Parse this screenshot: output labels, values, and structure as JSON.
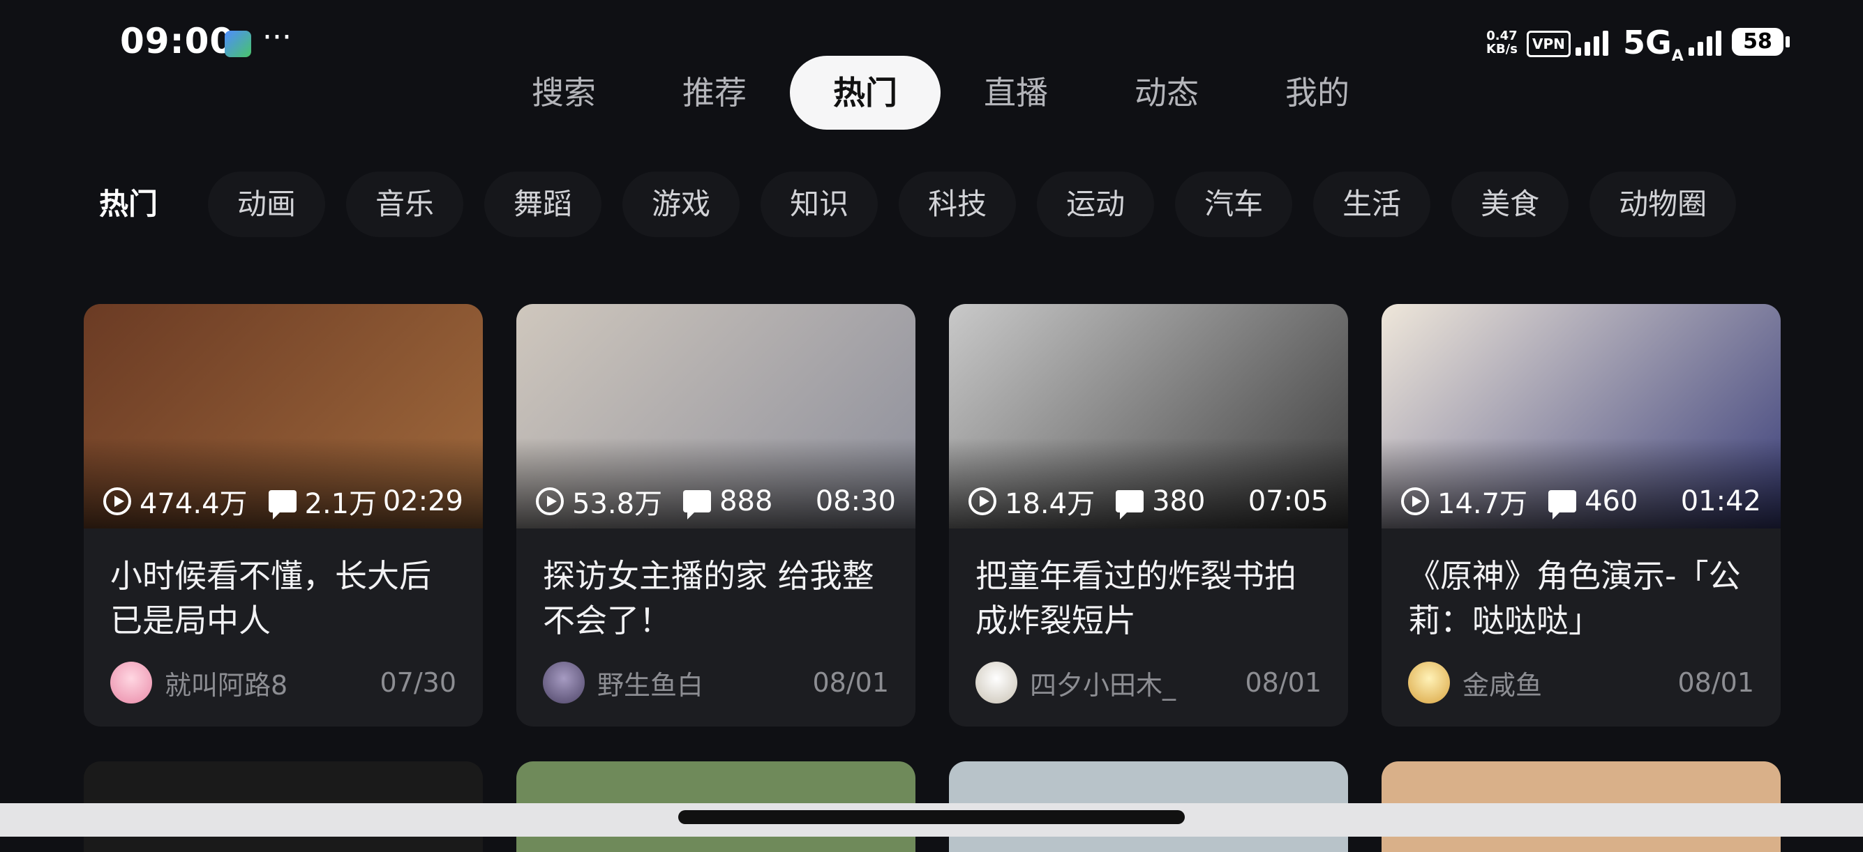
{
  "status_bar": {
    "time": "09:00",
    "app_icon": "app-notification-icon",
    "more": "···",
    "net_speed_value": "0.47",
    "net_speed_unit": "KB/s",
    "vpn": "VPN",
    "network": "5G",
    "network_suffix": "A",
    "battery": "58"
  },
  "top_tabs": [
    {
      "label": "搜索"
    },
    {
      "label": "推荐"
    },
    {
      "label": "热门",
      "active": true
    },
    {
      "label": "直播"
    },
    {
      "label": "动态"
    },
    {
      "label": "我的"
    }
  ],
  "categories": [
    {
      "label": "热门",
      "active": true
    },
    {
      "label": "动画"
    },
    {
      "label": "音乐"
    },
    {
      "label": "舞蹈"
    },
    {
      "label": "游戏"
    },
    {
      "label": "知识"
    },
    {
      "label": "科技"
    },
    {
      "label": "运动"
    },
    {
      "label": "汽车"
    },
    {
      "label": "生活"
    },
    {
      "label": "美食"
    },
    {
      "label": "动物圈"
    }
  ],
  "videos": [
    {
      "views": "474.4万",
      "comments": "2.1万",
      "duration": "02:29",
      "title": "小时候看不懂，长大后已是局中人",
      "author": "就叫阿路8",
      "date": "07/30",
      "thumb_colors": [
        "#6b3b24",
        "#a0693c"
      ]
    },
    {
      "views": "53.8万",
      "comments": "888",
      "duration": "08:30",
      "title": "探访女主播的家 给我整不会了！",
      "author": "野生鱼白",
      "date": "08/01",
      "thumb_colors": [
        "#cfc7bd",
        "#8b8d9a"
      ]
    },
    {
      "views": "18.4万",
      "comments": "380",
      "duration": "07:05",
      "title": "把童年看过的炸裂书拍成炸裂短片",
      "author": "四夕小田木_",
      "date": "08/01",
      "thumb_colors": [
        "#c9c9c9",
        "#3a3a3a"
      ]
    },
    {
      "views": "14.7万",
      "comments": "460",
      "duration": "01:42",
      "title": "《原神》角色演示-「公莉：哒哒哒」",
      "author": "金咸鱼",
      "date": "08/01",
      "thumb_colors": [
        "#efe7da",
        "#3b3f7a"
      ]
    }
  ],
  "row2_colors": [
    "#1a1a1a",
    "#6f8a5a",
    "#b8c3c9",
    "#d9b089"
  ]
}
